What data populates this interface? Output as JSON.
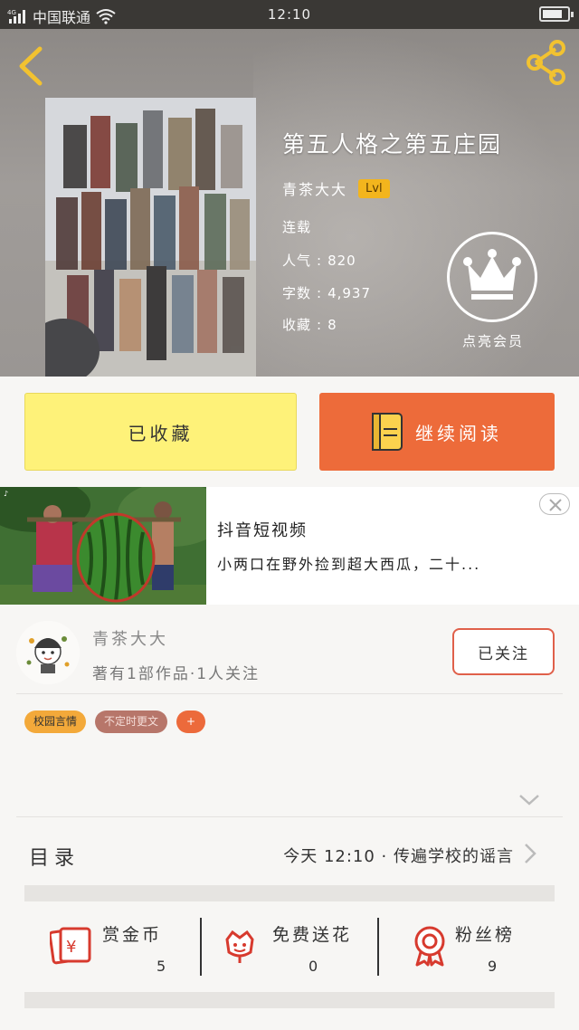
{
  "status_bar": {
    "network": "4G",
    "carrier": "中国联通",
    "time": "12:10"
  },
  "book": {
    "title": "第五人格之第五庄园",
    "author": "青茶大大",
    "level": "Lvl",
    "status": "连载",
    "popularity_label": "人气",
    "popularity_value": "820",
    "words_label": "字数",
    "words_value": "4,937",
    "favorites_label": "收藏",
    "favorites_value": "8"
  },
  "vip": {
    "label": "点亮会员"
  },
  "actions": {
    "collected_label": "已收藏",
    "continue_label": "继续阅读"
  },
  "ad": {
    "title": "抖音短视频",
    "description": "小两口在野外捡到超大西瓜，二十..."
  },
  "author_card": {
    "name": "青茶大大",
    "summary": "著有1部作品·1人关注",
    "follow_label": "已关注"
  },
  "tags": [
    "校园言情",
    "不定时更文",
    "+"
  ],
  "toc": {
    "label": "目录",
    "latest": "今天 12:10 · 传遍学校的谣言"
  },
  "stats": [
    {
      "label": "赏金币",
      "value": "5",
      "icon": "red-envelope-yuan-icon"
    },
    {
      "label": "免费送花",
      "value": "0",
      "icon": "flower-icon"
    },
    {
      "label": "粉丝榜",
      "value": "9",
      "icon": "medal-icon"
    }
  ],
  "colors": {
    "accent": "#ed6b3a",
    "collected_bg": "#fef279",
    "badge": "#f3b51d"
  }
}
